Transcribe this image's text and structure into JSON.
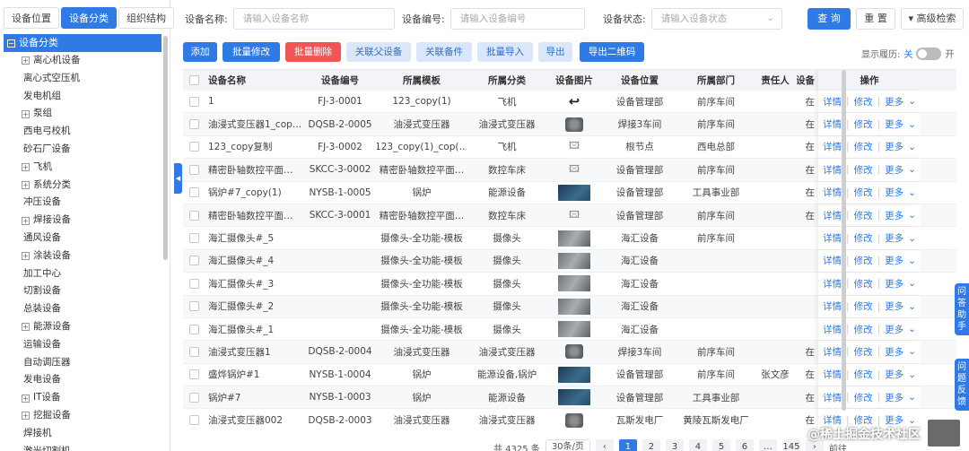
{
  "left_tabs": [
    {
      "label": "设备位置",
      "active": false
    },
    {
      "label": "设备分类",
      "active": true
    },
    {
      "label": "组织结构",
      "active": false
    }
  ],
  "tree": {
    "root": "设备分类",
    "nodes": [
      {
        "label": "离心机设备",
        "expandable": true
      },
      {
        "label": "离心式空压机",
        "expandable": false
      },
      {
        "label": "发电机组",
        "expandable": false
      },
      {
        "label": "泵组",
        "expandable": true
      },
      {
        "label": "西电弓校机",
        "expandable": false
      },
      {
        "label": "砂石厂设备",
        "expandable": false
      },
      {
        "label": "飞机",
        "expandable": true
      },
      {
        "label": "系统分类",
        "expandable": true
      },
      {
        "label": "冲压设备",
        "expandable": false
      },
      {
        "label": "焊接设备",
        "expandable": true
      },
      {
        "label": "通风设备",
        "expandable": false
      },
      {
        "label": "涂装设备",
        "expandable": true
      },
      {
        "label": "加工中心",
        "expandable": false
      },
      {
        "label": "切割设备",
        "expandable": false
      },
      {
        "label": "总装设备",
        "expandable": false
      },
      {
        "label": "能源设备",
        "expandable": true
      },
      {
        "label": "运输设备",
        "expandable": false
      },
      {
        "label": "自动调压器",
        "expandable": false
      },
      {
        "label": "发电设备",
        "expandable": false
      },
      {
        "label": "IT设备",
        "expandable": true
      },
      {
        "label": "挖掘设备",
        "expandable": true
      },
      {
        "label": "焊接机",
        "expandable": false
      },
      {
        "label": "激光切割机",
        "expandable": false
      }
    ]
  },
  "search": {
    "name_label": "设备名称:",
    "name_placeholder": "请输入设备名称",
    "code_label": "设备编号:",
    "code_placeholder": "请输入设备编号",
    "status_label": "设备状态:",
    "status_placeholder": "请输入设备状态",
    "query": "查 询",
    "reset": "重 置",
    "advanced": "▾ 高级检索"
  },
  "toolbar": {
    "add": "添加",
    "batch_edit": "批量修改",
    "batch_delete": "批量删除",
    "link_parent": "关联父设备",
    "link_spare": "关联备件",
    "batch_import": "批量导入",
    "export": "导出",
    "export_qr": "导出二维码"
  },
  "history": {
    "label": "显示履历:",
    "off": "关",
    "on": "开"
  },
  "table": {
    "headers": {
      "name": "设备名称",
      "code": "设备编号",
      "template": "所属模板",
      "category": "所属分类",
      "image": "设备图片",
      "location": "设备位置",
      "dept": "所属部门",
      "responsible": "责任人",
      "extra": "设备",
      "ops": "操作"
    },
    "op_labels": {
      "detail": "详情",
      "edit": "修改",
      "more": "更多"
    },
    "rows": [
      {
        "name": "1",
        "code": "FJ-3-0001",
        "template": "123_copy(1)",
        "category": "飞机",
        "image": "back",
        "location": "设备管理部",
        "dept": "前序车间",
        "responsible": "",
        "extra": "在"
      },
      {
        "name": "油浸式变压器1_cop…",
        "code": "DQSB-2-0005",
        "template": "油浸式变压器",
        "category": "油浸式变压器",
        "image": "transformer",
        "location": "焊接3车间",
        "dept": "前序车间",
        "responsible": "",
        "extra": "在"
      },
      {
        "name": "123_copy复制",
        "code": "FJ-3-0002",
        "template": "123_copy(1)_cop(…",
        "category": "飞机",
        "image": "broken",
        "location": "根节点",
        "dept": "西电总部",
        "responsible": "",
        "extra": "在"
      },
      {
        "name": "精密卧轴数控平面…",
        "code": "SKCC-3-0002",
        "template": "精密卧轴数控平面…",
        "category": "数控车床",
        "image": "broken",
        "location": "设备管理部",
        "dept": "前序车间",
        "responsible": "",
        "extra": "在"
      },
      {
        "name": "锅炉#7_copy(1)",
        "code": "NYSB-1-0005",
        "template": "锅炉",
        "category": "能源设备",
        "image": "photo",
        "location": "设备管理部",
        "dept": "工具事业部",
        "responsible": "",
        "extra": "在"
      },
      {
        "name": "精密卧轴数控平面…",
        "code": "SKCC-3-0001",
        "template": "精密卧轴数控平面…",
        "category": "数控车床",
        "image": "broken",
        "location": "设备管理部",
        "dept": "前序车间",
        "responsible": "",
        "extra": "在"
      },
      {
        "name": "海汇摄像头#_5",
        "code": "",
        "template": "摄像头-全功能-模板",
        "category": "摄像头",
        "image": "camera",
        "location": "海汇设备",
        "dept": "前序车间",
        "responsible": "",
        "extra": ""
      },
      {
        "name": "海汇摄像头#_4",
        "code": "",
        "template": "摄像头-全功能-模板",
        "category": "摄像头",
        "image": "camera",
        "location": "海汇设备",
        "dept": "",
        "responsible": "",
        "extra": ""
      },
      {
        "name": "海汇摄像头#_3",
        "code": "",
        "template": "摄像头-全功能-模板",
        "category": "摄像头",
        "image": "camera",
        "location": "海汇设备",
        "dept": "",
        "responsible": "",
        "extra": ""
      },
      {
        "name": "海汇摄像头#_2",
        "code": "",
        "template": "摄像头-全功能-模板",
        "category": "摄像头",
        "image": "camera",
        "location": "海汇设备",
        "dept": "",
        "responsible": "",
        "extra": ""
      },
      {
        "name": "海汇摄像头#_1",
        "code": "",
        "template": "摄像头-全功能-模板",
        "category": "摄像头",
        "image": "camera",
        "location": "海汇设备",
        "dept": "",
        "responsible": "",
        "extra": ""
      },
      {
        "name": "油浸式变压器1",
        "code": "DQSB-2-0004",
        "template": "油浸式变压器",
        "category": "油浸式变压器",
        "image": "transformer",
        "location": "焊接3车间",
        "dept": "前序车间",
        "responsible": "",
        "extra": "在"
      },
      {
        "name": "盛烨锅炉#1",
        "code": "NYSB-1-0004",
        "template": "锅炉",
        "category": "能源设备,锅炉",
        "image": "photo",
        "location": "设备管理部",
        "dept": "前序车间",
        "responsible": "张文彦",
        "extra": "在"
      },
      {
        "name": "锅炉#7",
        "code": "NYSB-1-0003",
        "template": "锅炉",
        "category": "能源设备",
        "image": "photo",
        "location": "设备管理部",
        "dept": "工具事业部",
        "responsible": "",
        "extra": "在"
      },
      {
        "name": "油浸式变压器002",
        "code": "DQSB-2-0003",
        "template": "油浸式变压器",
        "category": "油浸式变压器",
        "image": "transformer",
        "location": "瓦斯发电厂",
        "dept": "黄陵瓦斯发电厂",
        "responsible": "",
        "extra": "在"
      }
    ]
  },
  "pager": {
    "total": "共 4325 条",
    "page_size": "30条/页",
    "pages": [
      "1",
      "2",
      "3",
      "4",
      "5",
      "6",
      "…",
      "145"
    ],
    "current": "1",
    "prev": "‹",
    "next": "›",
    "goto": "前往"
  },
  "side_tabs": {
    "qa": [
      "问",
      "答",
      "助",
      "手"
    ],
    "feedback": [
      "问",
      "题",
      "反",
      "馈"
    ]
  },
  "watermark": "@稀土掘金技术社区",
  "colors": {
    "primary": "#2f7ae5",
    "danger": "#f05656",
    "light": "#d9e7f9"
  }
}
